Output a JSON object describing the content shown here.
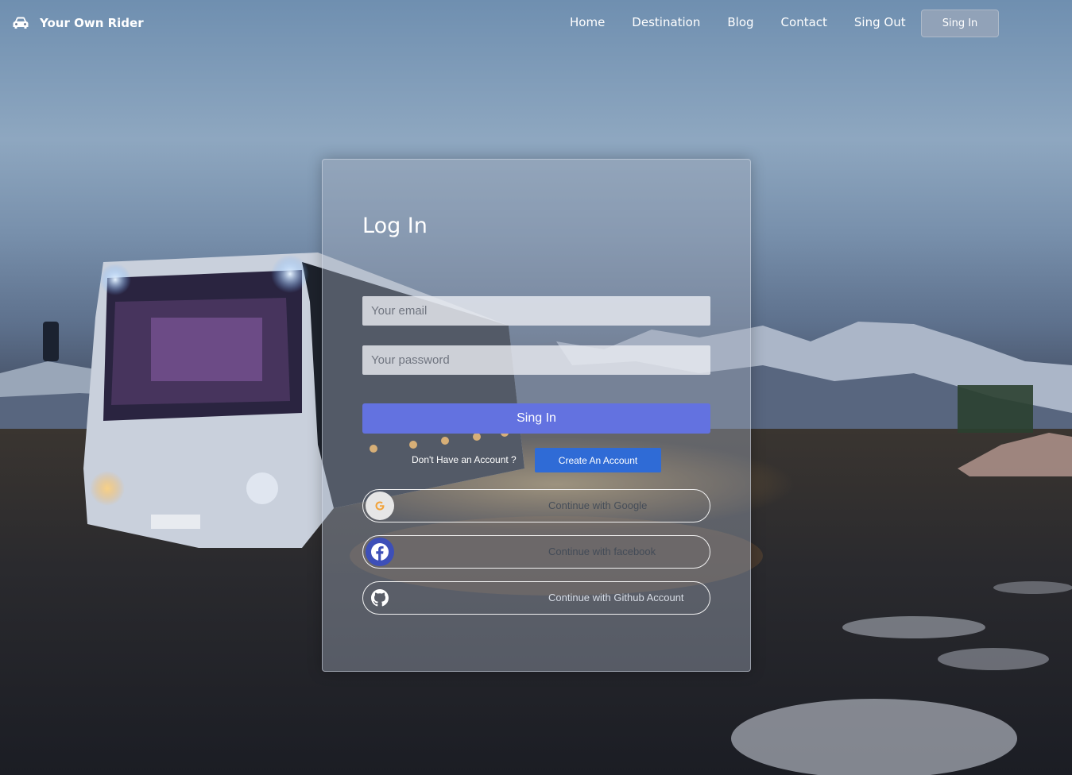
{
  "navbar": {
    "brand": "Your Own Rider",
    "brand_icon": "car-icon",
    "links": [
      "Home",
      "Destination",
      "Blog",
      "Contact",
      "Sing Out"
    ],
    "signin_label": "Sing In"
  },
  "login": {
    "title": "Log In",
    "email_placeholder": "Your email",
    "password_placeholder": "Your password",
    "submit_label": "Sing In",
    "no_account_text": "Don't Have an Account ?",
    "create_account_label": "Create An Account",
    "social": {
      "google": "Continue with Google",
      "facebook": "Continue with facebook",
      "github": "Continue with Github Account"
    }
  },
  "colors": {
    "primary_button": "#6372e0",
    "create_button": "#2f6bd6",
    "facebook_blue": "#3d4fb8"
  }
}
